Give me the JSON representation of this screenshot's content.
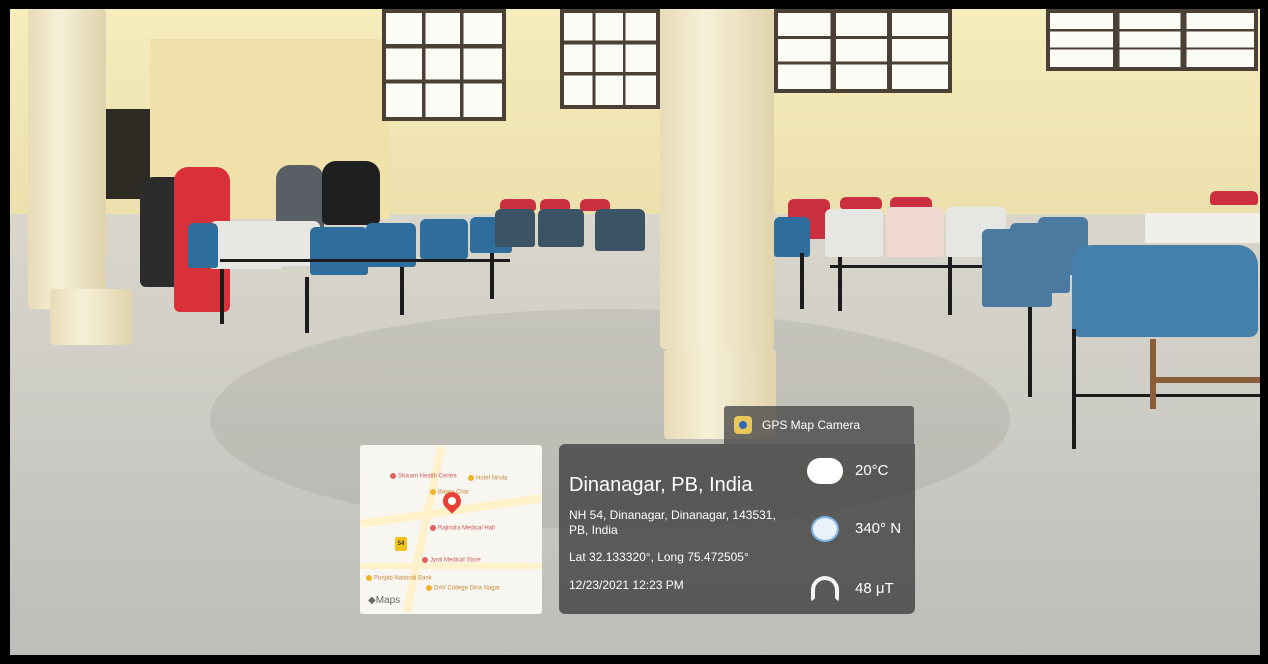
{
  "overlay": {
    "app_name": "GPS Map Camera",
    "location_title": "Dinanagar, PB, India",
    "address": "NH 54, Dinanagar, Dinanagar, 143531, PB, India",
    "coordinates": "Lat 32.133320°, Long 75.472505°",
    "datetime": "12/23/2021 12:23 PM",
    "temperature": "20°C",
    "heading": "340° N",
    "magnetic_field": "48 μT",
    "icons": [
      "app-logo-icon",
      "cloud-icon",
      "compass-icon",
      "magnet-icon",
      "map-pin-icon"
    ]
  },
  "map": {
    "attribution": "Maps",
    "route_label": "54",
    "pois": [
      {
        "label": "Shivam Health Centre",
        "color": "red"
      },
      {
        "label": "Bajwa Chat",
        "color": "yellow"
      },
      {
        "label": "Hotel Nirula",
        "color": "yellow"
      },
      {
        "label": "Rajindra Medical Hall",
        "color": "red"
      },
      {
        "label": "Jyoti Medical Store",
        "color": "red"
      },
      {
        "label": "DAV College Dina Nagar",
        "color": "yellow"
      },
      {
        "label": "Punjab National Bank",
        "color": "yellow"
      }
    ]
  }
}
